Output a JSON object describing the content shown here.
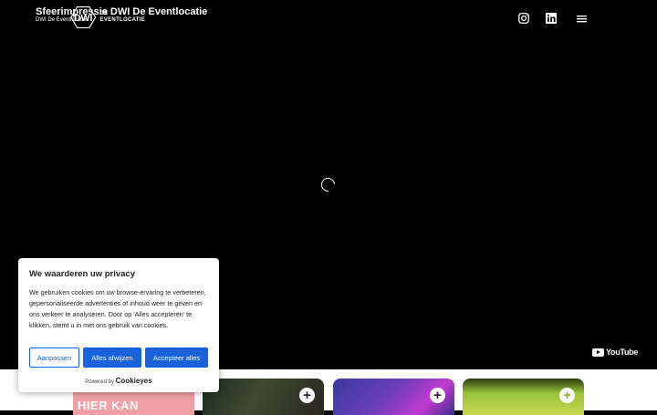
{
  "video": {
    "title": "Sfeerimpressie DWI De Eventlocatie",
    "channel": "DWI De Eventlocatie",
    "logo_mark": "DWI",
    "logo_text": "DE EVENTLOCATIE",
    "youtube_label": "YouTube"
  },
  "header_icons": [
    "instagram-icon",
    "linkedin-icon",
    "menu-icon"
  ],
  "cards": [
    {
      "text": "HIER KAN"
    },
    {
      "text": ""
    },
    {
      "text": ""
    },
    {
      "text": ""
    }
  ],
  "cookie": {
    "title": "We waarderen uw privacy",
    "body": "We gebruiken cookies om uw browse-ervaring te verbeteren, gepersonaliseerde advertenties of inhoud weer te geven en ons verkeer te analyseren. Door op 'Alles accepteren' te klikken, stemt u in met ons gebruik van cookies.",
    "customize": "Aanpassen",
    "reject": "Alles afwijzen",
    "accept": "Accepteer alles",
    "powered_by": "Powered by",
    "brand": "Cookieyes"
  },
  "colors": {
    "accent": "#1863dc",
    "card1": "#f2a0a8"
  }
}
